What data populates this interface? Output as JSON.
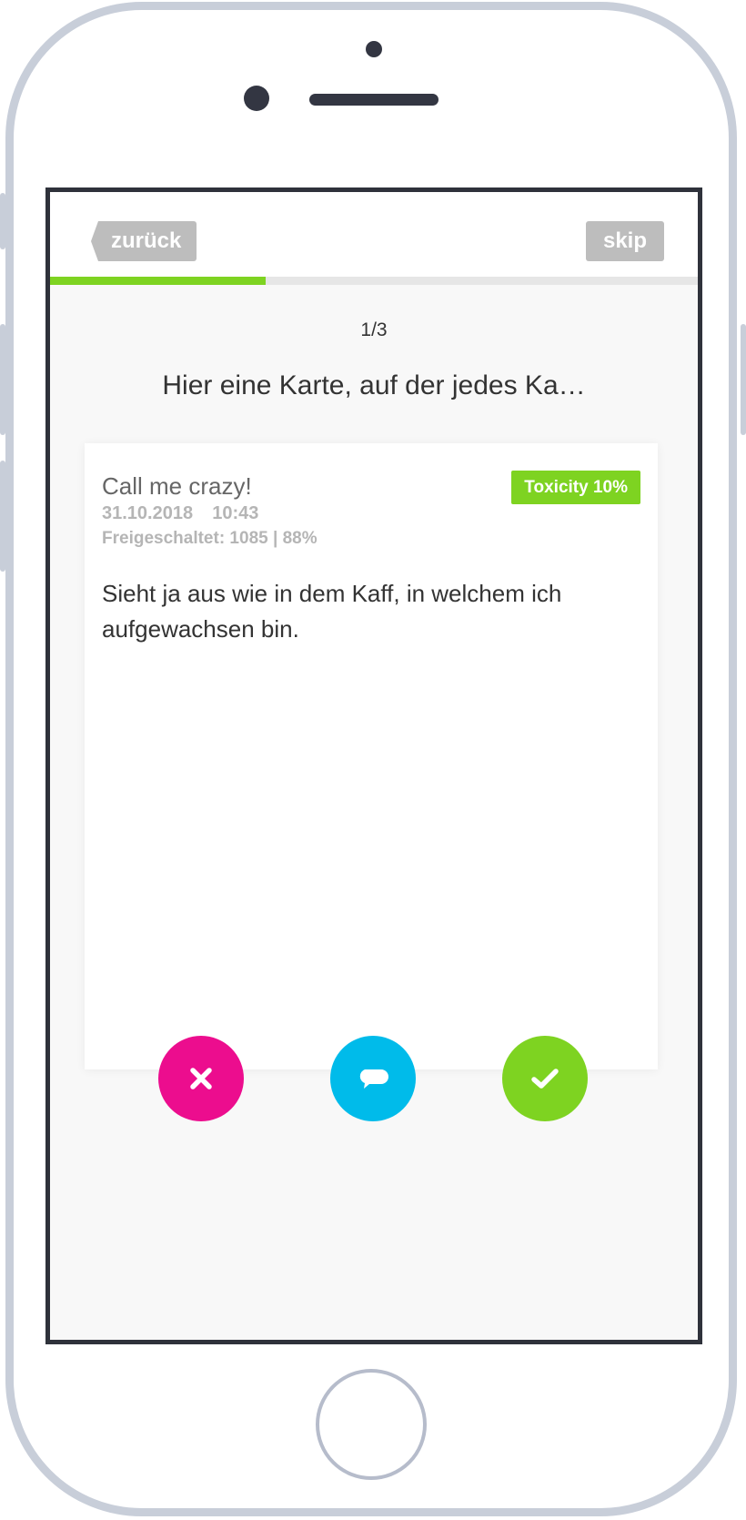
{
  "nav": {
    "back_label": "zurück",
    "skip_label": "skip"
  },
  "progress": {
    "current": 1,
    "total": 3,
    "fraction": 0.333,
    "step_label": "1/3"
  },
  "question": "Hier eine Karte, auf der jedes Ka…",
  "card": {
    "title": "Call me crazy!",
    "date": "31.10.2018",
    "time": "10:43",
    "unlocked": "Freigeschaltet: 1085 | 88%",
    "toxicity_badge": "Toxicity 10%",
    "comment": "Sieht ja aus wie in dem Kaff, in welchem ich aufgewachsen bin."
  },
  "actions": [
    {
      "name": "reject",
      "icon": "close-icon",
      "color": "#ec0d8e"
    },
    {
      "name": "comment",
      "icon": "speech-bubble-icon",
      "color": "#00bbea"
    },
    {
      "name": "approve",
      "icon": "checkmark-icon",
      "color": "#7ed321"
    }
  ],
  "colors": {
    "accent_green": "#7ed321",
    "button_gray": "#bdbdbd",
    "frame": "#c8ced9"
  }
}
